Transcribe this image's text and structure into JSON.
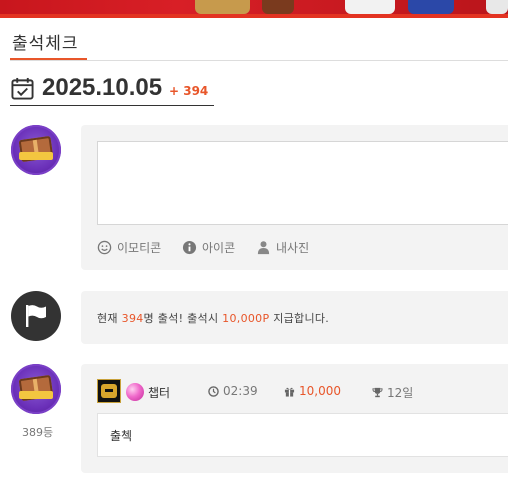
{
  "colors": {
    "accent": "#e8562a",
    "banner_red": "#c8161d",
    "card_bg": "#f3f3f3"
  },
  "header": {
    "title": "출석체크"
  },
  "date_header": {
    "date": "2025.10.05",
    "count": "+ 394",
    "icon": "calendar-check-icon"
  },
  "editor": {
    "textarea_placeholder": "",
    "tools": [
      {
        "label": "이모티콘",
        "icon": "smiley-icon"
      },
      {
        "label": "아이콘",
        "icon": "info-icon"
      },
      {
        "label": "내사진",
        "icon": "user-icon"
      }
    ]
  },
  "notice": {
    "prefix": "현재 ",
    "count": "394",
    "middle": "명 출석! 출석시 ",
    "points": "10,000P",
    "suffix": " 지급합니다.",
    "icon": "flag-icon"
  },
  "entry": {
    "rank": "389등",
    "username": "챕터",
    "time": "02:39",
    "points": "10,000",
    "streak": "12일",
    "comment": "출첵"
  }
}
